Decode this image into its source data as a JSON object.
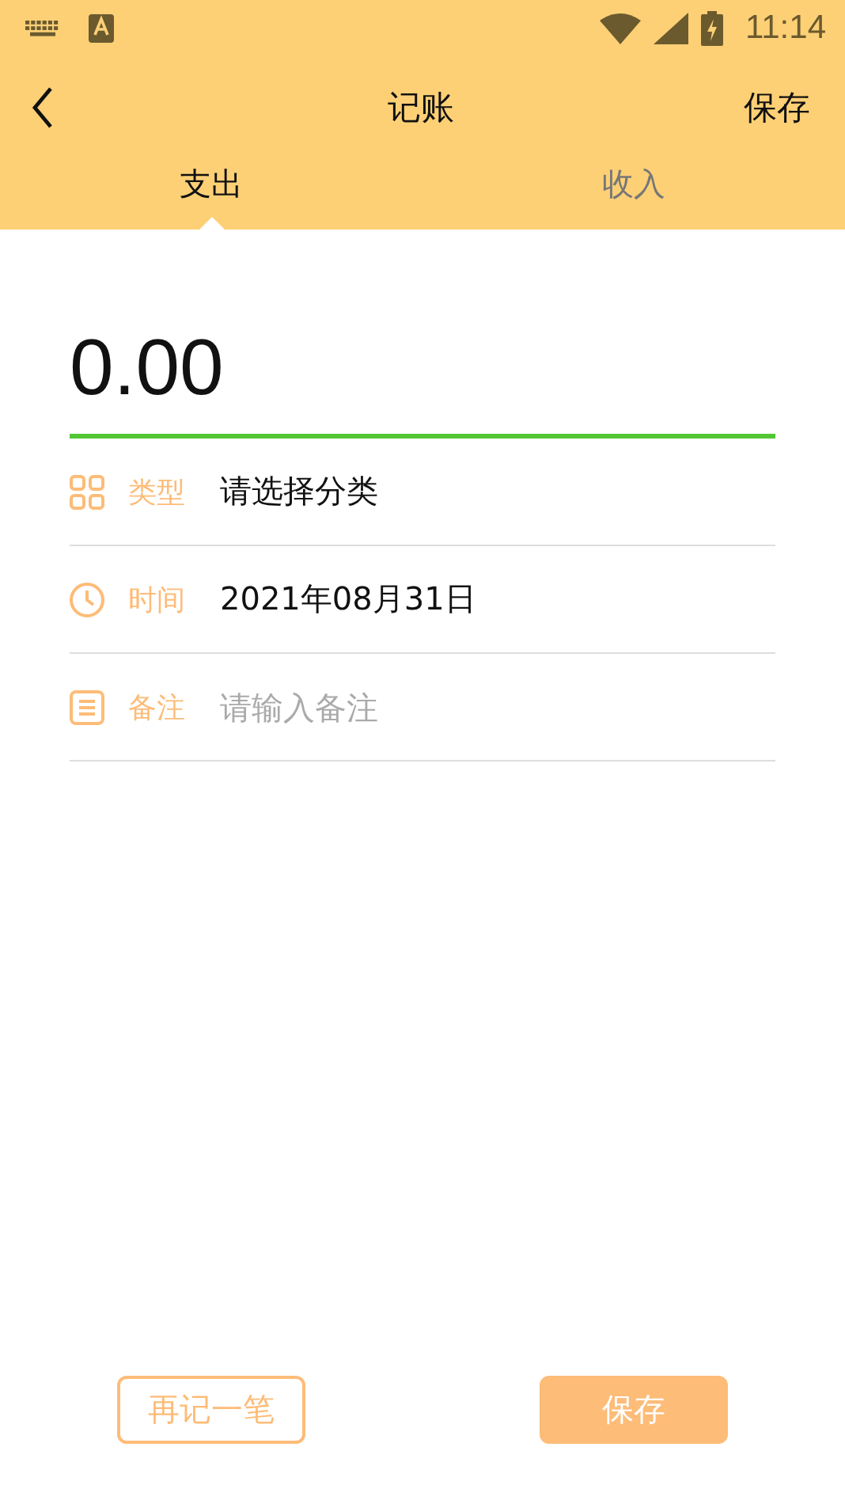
{
  "status_bar": {
    "time": "11:14"
  },
  "toolbar": {
    "title": "记账",
    "action": "保存"
  },
  "tabs": [
    {
      "label": "支出",
      "selected": true
    },
    {
      "label": "收入",
      "selected": false
    }
  ],
  "amount": {
    "value": "0.00"
  },
  "fields": [
    {
      "kind": "category",
      "label": "类型",
      "value": "请选择分类"
    },
    {
      "kind": "date",
      "label": "时间",
      "value": "2021年08月31日"
    },
    {
      "kind": "note",
      "label": "备注",
      "placeholder": "请输入备注"
    }
  ],
  "buttons": [
    {
      "kind": "outline",
      "label": "再记一笔"
    },
    {
      "kind": "filled",
      "label": "保存"
    }
  ]
}
